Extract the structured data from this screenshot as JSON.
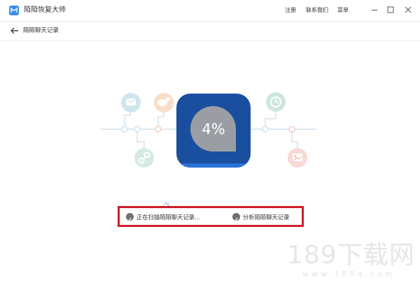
{
  "window": {
    "title": "陌陌恢复大师",
    "links": {
      "register": "注册",
      "contact": "联系我们",
      "menu": "菜单"
    }
  },
  "nav": {
    "back_label": "陌陌聊天记录"
  },
  "progress": {
    "percent_text": "4%",
    "value": 0.04
  },
  "status": {
    "scanning": {
      "icon": "pencil-icon",
      "label": "正在扫描陌陌聊天记录..."
    },
    "analyzing": {
      "icon": "pencil-icon",
      "label": "分析陌陌聊天记录"
    }
  },
  "watermark": {
    "text": "189下载网",
    "sub": "www.189d.com"
  },
  "colors": {
    "accent": "#1a4fa0",
    "highlight_border": "#cc1f2a",
    "node_line": "#c5d8ea",
    "mail_circle": "#cfe6ec",
    "chat_circle": "#f8ddc8",
    "clock_circle": "#cde6e0",
    "link_circle": "#d5eae5",
    "image_circle": "#f8d9d5"
  }
}
